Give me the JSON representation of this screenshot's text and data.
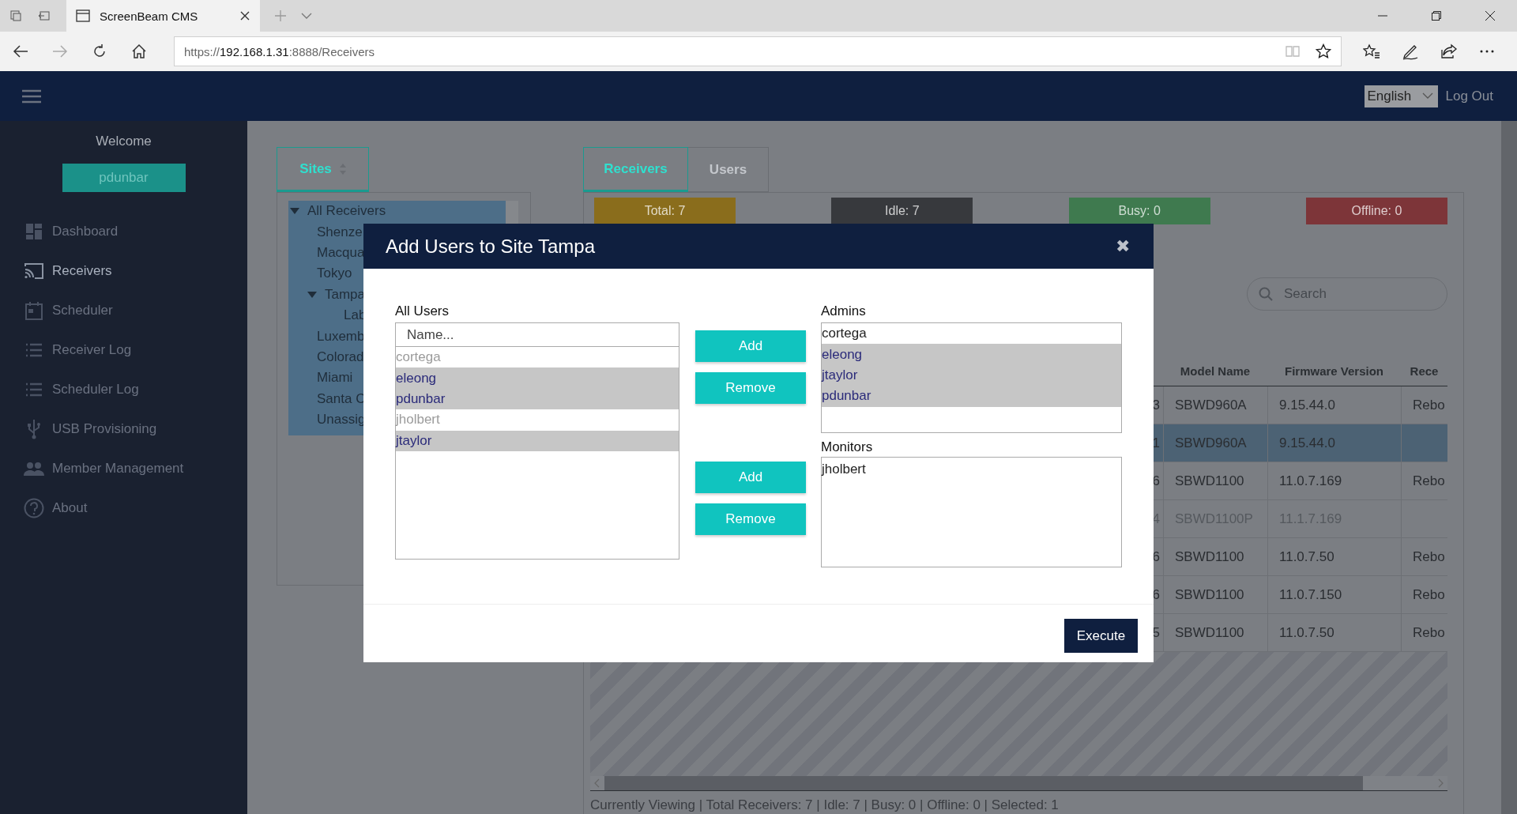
{
  "browser": {
    "tab_title": "ScreenBeam CMS",
    "url": {
      "scheme": "https://",
      "host": "192.168.1.31",
      "rest": ":8888/Receivers"
    }
  },
  "header": {
    "language": "English",
    "logout": "Log Out"
  },
  "sidebar": {
    "welcome": "Welcome",
    "user": "pdunbar",
    "items": [
      {
        "label": "Dashboard",
        "selected": false
      },
      {
        "label": "Receivers",
        "selected": true
      },
      {
        "label": "Scheduler",
        "selected": false
      },
      {
        "label": "Receiver Log",
        "selected": false
      },
      {
        "label": "Scheduler Log",
        "selected": false
      },
      {
        "label": "USB Provisioning",
        "selected": false
      },
      {
        "label": "Member Management",
        "selected": false
      },
      {
        "label": "About",
        "selected": false
      }
    ]
  },
  "sites_panel": {
    "tab": "Sites",
    "tree": [
      {
        "label": "All Receivers",
        "expanded": true,
        "children": [
          {
            "label": "Shenze"
          },
          {
            "label": "Macqua"
          },
          {
            "label": "Tokyo"
          },
          {
            "label": "Tampa",
            "expanded": true,
            "children": [
              {
                "label": "Lab"
              }
            ]
          },
          {
            "label": "Luxemb"
          },
          {
            "label": "Colorad"
          },
          {
            "label": "Miami"
          },
          {
            "label": "Santa C"
          },
          {
            "label": "Unassig"
          }
        ]
      }
    ]
  },
  "receivers_panel": {
    "tabs": [
      {
        "label": "Receivers",
        "selected": true
      },
      {
        "label": "Users",
        "selected": false
      }
    ],
    "summary": [
      {
        "label": "Total: 7",
        "color": "#8a6d1c"
      },
      {
        "label": "Idle: 7",
        "color": "#37393d"
      },
      {
        "label": "Busy: 0",
        "color": "#3f7a4f"
      },
      {
        "label": "Offline: 0",
        "color": "#7d3539"
      }
    ],
    "search": {
      "placeholder": "Search"
    },
    "table": {
      "columns": [
        "Model Name",
        "Firmware Version",
        "Rece"
      ],
      "rows": [
        {
          "column_1": "3",
          "model": "SBWD960A",
          "firmware": "9.15.44.0",
          "column_4": "Rebo",
          "selected": false,
          "disabled": false
        },
        {
          "column_1": "1",
          "model": "SBWD960A",
          "firmware": "9.15.44.0",
          "selected": true,
          "disabled": false
        },
        {
          "column_1": "6",
          "model": "SBWD1100",
          "firmware": "11.0.7.169",
          "column_4": "Rebo",
          "selected": false,
          "disabled": false
        },
        {
          "column_1": "4",
          "model": "SBWD1100P",
          "firmware": "11.1.7.169",
          "selected": false,
          "disabled": true
        },
        {
          "column_1": "6",
          "model": "SBWD1100",
          "firmware": "11.0.7.50",
          "column_4": "Rebo",
          "selected": false,
          "disabled": false
        },
        {
          "column_1": "6",
          "model": "SBWD1100",
          "firmware": "11.0.7.150",
          "column_4": "Rebo",
          "selected": false,
          "disabled": false
        },
        {
          "column_1": "5",
          "model": "SBWD1100",
          "firmware": "11.0.7.50",
          "column_4": "Rebo",
          "selected": false,
          "disabled": false
        }
      ]
    },
    "status_bar": "Currently Viewing | Total Receivers: 7 | Idle: 7 | Busy: 0 | Offline: 0 | Selected: 1"
  },
  "modal": {
    "title": "Add Users to Site Tampa",
    "close": "✖",
    "all_users": {
      "label": "All Users",
      "placeholder": "Name...",
      "items": [
        {
          "name": "cortega",
          "selected": false,
          "disabled": true
        },
        {
          "name": "eleong",
          "selected": true,
          "disabled": false
        },
        {
          "name": "pdunbar",
          "selected": true,
          "disabled": false
        },
        {
          "name": "jholbert",
          "selected": false,
          "disabled": true
        },
        {
          "name": "jtaylor",
          "selected": true,
          "disabled": false
        }
      ]
    },
    "admin_buttons": [
      "Add",
      "Remove"
    ],
    "monitor_buttons": [
      "Add",
      "Remove"
    ],
    "admins": {
      "label": "Admins",
      "items": [
        {
          "name": "cortega",
          "selected": false
        },
        {
          "name": "eleong",
          "selected": true
        },
        {
          "name": "jtaylor",
          "selected": true
        },
        {
          "name": "pdunbar",
          "selected": true
        }
      ]
    },
    "monitors": {
      "label": "Monitors",
      "items": [
        {
          "name": "jholbert",
          "selected": false
        }
      ]
    },
    "execute": "Execute"
  }
}
